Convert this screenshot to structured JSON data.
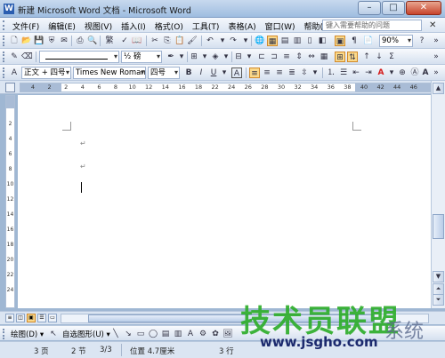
{
  "window": {
    "title": "新建 Microsoft Word 文档 - Microsoft Word",
    "app_icon": "W",
    "min_label": "–",
    "max_label": "□",
    "close_label": "✕"
  },
  "menu": {
    "items": [
      "文件(F)",
      "编辑(E)",
      "视图(V)",
      "插入(I)",
      "格式(O)",
      "工具(T)",
      "表格(A)",
      "窗口(W)",
      "帮助(H)"
    ],
    "help_placeholder": "键入需要帮助的问题",
    "close_doc": "✕"
  },
  "toolbar_standard": {
    "convert_label": "繁",
    "zoom": "90%"
  },
  "toolbar_drawing_lines": {
    "line_weight": "½ 磅"
  },
  "toolbar_formatting": {
    "style": "正文 + 四号",
    "font": "Times New Roman",
    "size": "四号",
    "bold": "B",
    "italic": "I",
    "underline": "U",
    "char_border": "A"
  },
  "ruler": {
    "h_ticks": [
      "4",
      "2",
      "2",
      "4",
      "6",
      "8",
      "10",
      "12",
      "14",
      "16",
      "18",
      "22",
      "24",
      "26",
      "28",
      "30",
      "32",
      "34",
      "36",
      "38",
      "40",
      "42",
      "44",
      "46"
    ],
    "v_ticks": [
      "2",
      "4",
      "6",
      "8",
      "10",
      "12",
      "14",
      "16",
      "18",
      "20",
      "22",
      "24"
    ]
  },
  "document": {
    "paragraph_mark": "↵"
  },
  "drawing_bar": {
    "draw_label": "绘图(D) ▾",
    "autoshape_label": "自选图形(U) ▾"
  },
  "status": {
    "page": "3 页",
    "section": "2 节",
    "page_of": "3/3",
    "position": "位置 4.7厘米",
    "line": "3 行"
  },
  "watermark": {
    "brand": "技术员联盟",
    "url": "www.jsgho.com",
    "side": "系统"
  },
  "colors": {
    "title_gradient_top": "#c7d9ee",
    "toolbar_bg": "#dbe5f2",
    "highlight": "#fbd98a",
    "font_color_red": "#d41a1a",
    "watermark_green": "#2fae2c"
  }
}
